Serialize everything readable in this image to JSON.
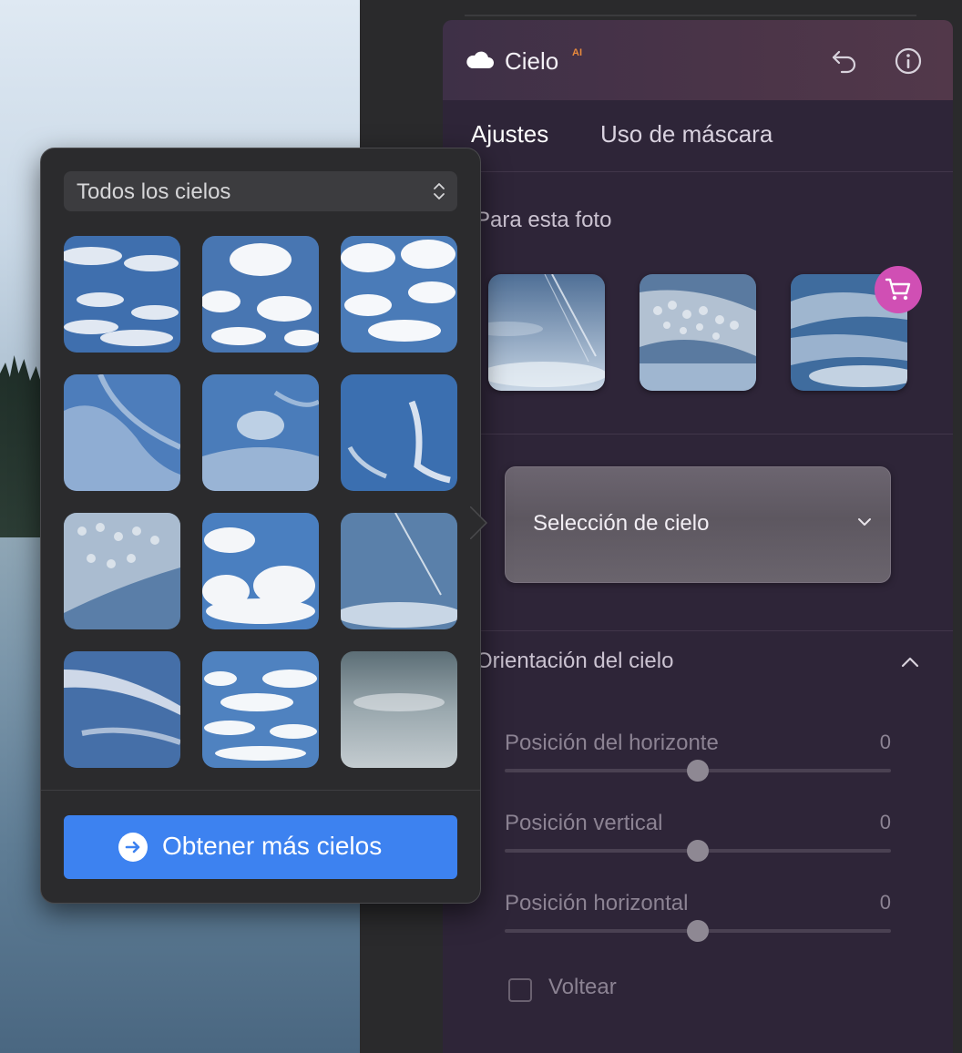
{
  "panel": {
    "title": "Cielo",
    "ai_badge": "AI",
    "icons": [
      "cloud-icon",
      "undo-icon",
      "info-icon"
    ],
    "tabs": [
      {
        "label": "Ajustes",
        "active": true
      },
      {
        "label": "Uso de máscara",
        "active": false
      }
    ],
    "for_photo_label": "Para esta foto",
    "thumbnails": [
      {
        "name": "sky-thumb-streaks"
      },
      {
        "name": "sky-thumb-mackerel"
      },
      {
        "name": "sky-thumb-wispy",
        "premium": true
      }
    ],
    "sky_selection": {
      "label": "Selección de cielo"
    },
    "orientation": {
      "title": "Orientación del cielo",
      "sliders": [
        {
          "label": "Posición del horizonte",
          "value": "0",
          "level": 0.5
        },
        {
          "label": "Posición vertical",
          "value": "0",
          "level": 0.5
        },
        {
          "label": "Posición horizontal",
          "value": "0",
          "level": 0.5
        }
      ],
      "flip": {
        "label": "Voltear",
        "checked": false
      }
    }
  },
  "popover": {
    "dropdown": {
      "value": "Todos los cielos"
    },
    "skies": [
      "sky-cumulus-low",
      "sky-cumulus-puffy",
      "sky-cumulus-bright",
      "sky-cirrus-soft",
      "sky-cirrus-feather",
      "sky-cirrus-hook",
      "sky-altocumulus",
      "sky-cumulus-towers",
      "sky-contrails",
      "sky-cirrostratus",
      "sky-cumulus-scattered",
      "sky-overcast"
    ],
    "cta": {
      "label": "Obtener más cielos"
    }
  },
  "colors": {
    "accent_blue": "#3d82f0",
    "cart_pink": "#d04fb4",
    "ai_orange": "#e88a3c",
    "panel_bg": "#2e2538"
  }
}
